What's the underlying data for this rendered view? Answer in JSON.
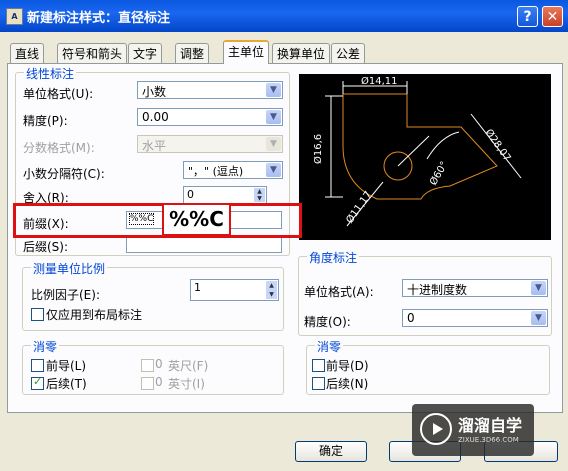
{
  "window": {
    "title": "新建标注样式：直径标注",
    "icon_text": "A"
  },
  "title_buttons": {
    "help": "?",
    "close": "✕"
  },
  "tabs": [
    {
      "label": "直线"
    },
    {
      "label": "符号和箭头"
    },
    {
      "label": "文字"
    },
    {
      "label": "调整"
    },
    {
      "label": "主单位",
      "active": true
    },
    {
      "label": "换算单位"
    },
    {
      "label": "公差"
    }
  ],
  "linear": {
    "title": "线性标注",
    "unit_format": {
      "label": "单位格式(U):",
      "value": "小数"
    },
    "precision": {
      "label": "精度(P):",
      "value": "0.00"
    },
    "fraction_format": {
      "label": "分数格式(M):",
      "value": "水平"
    },
    "decimal_separator": {
      "label": "小数分隔符(C):",
      "value": "\"，\" (逗点)"
    },
    "round_off": {
      "label": "舍入(R):",
      "value": "0"
    },
    "prefix": {
      "label": "前缀(X):",
      "value": "%%C"
    },
    "suffix": {
      "label": "后缀(S):",
      "value": ""
    }
  },
  "scale": {
    "title": "测量单位比例",
    "factor": {
      "label": "比例因子(E):",
      "value": "1"
    },
    "layout_only": {
      "label": "仅应用到布局标注",
      "checked": false
    }
  },
  "zero_left": {
    "title": "消零",
    "leading": {
      "label": "前导(L)",
      "checked": false
    },
    "trailing": {
      "label": "后续(T)",
      "checked": true
    },
    "feet": {
      "value": "0",
      "label": "英尺(F)",
      "checked": false
    },
    "inches": {
      "value": "0",
      "label": "英寸(I)",
      "checked": false
    }
  },
  "angular": {
    "title": "角度标注",
    "unit_format": {
      "label": "单位格式(A):",
      "value": "十进制度数"
    },
    "precision": {
      "label": "精度(O):",
      "value": "0"
    }
  },
  "zero_right": {
    "title": "消零",
    "leading": {
      "label": "前导(D)",
      "checked": false
    },
    "trailing": {
      "label": "后续(N)",
      "checked": false
    }
  },
  "preview": {
    "dim_top": "Ø14,11",
    "dim_left": "Ø16,6",
    "dim_right": "Ø28,07",
    "dim_angle": "Ø60°",
    "dim_diag": "Ø11,17",
    "colors": {
      "background": "#000000",
      "lines": "#ffffff",
      "geometry": "#e08a1e"
    }
  },
  "callout": {
    "text": "%%C",
    "color": "#dd1111"
  },
  "buttons": {
    "ok": "确定"
  },
  "watermark": {
    "title": "溜溜自学",
    "url": "ZIXUE.3D66.COM"
  }
}
